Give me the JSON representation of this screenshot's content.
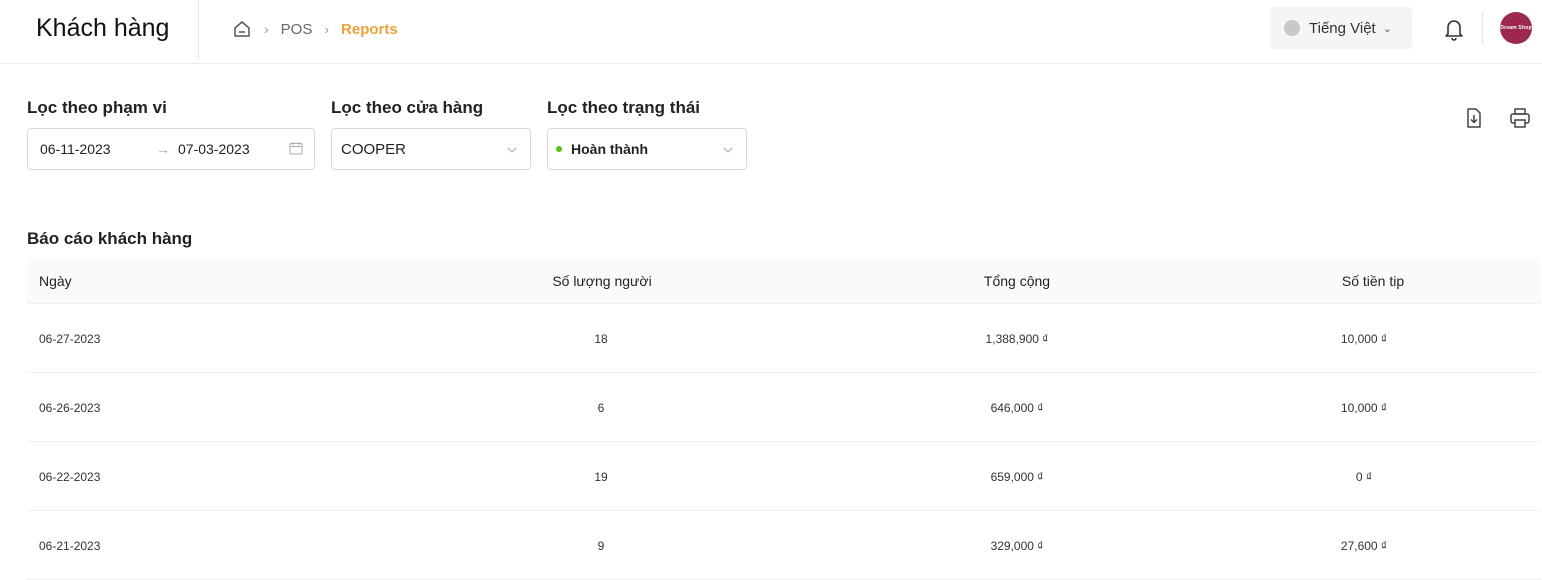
{
  "header": {
    "title": "Khách hàng",
    "breadcrumb": [
      {
        "label": "POS"
      },
      {
        "label": "Reports"
      }
    ],
    "language": "Tiếng Việt",
    "avatar_text": "Dream Shop"
  },
  "filters": {
    "range_label": "Lọc theo phạm vi",
    "start_date": "06-11-2023",
    "end_date": "07-03-2023",
    "store_label": "Lọc theo cửa hàng",
    "store_value": "COOPER",
    "status_label": "Lọc theo trạng thái",
    "status_value": "Hoàn thành"
  },
  "report": {
    "title": "Báo cáo khách hàng",
    "columns": [
      "Ngày",
      "Số lượng người",
      "Tổng cộng",
      "Số tiền tip"
    ],
    "rows": [
      {
        "date": "06-27-2023",
        "people": "18",
        "total": "1,388,900 ₫",
        "tip": "10,000 ₫"
      },
      {
        "date": "06-26-2023",
        "people": "6",
        "total": "646,000 ₫",
        "tip": "10,000 ₫"
      },
      {
        "date": "06-22-2023",
        "people": "19",
        "total": "659,000 ₫",
        "tip": "0 ₫"
      },
      {
        "date": "06-21-2023",
        "people": "9",
        "total": "329,000 ₫",
        "tip": "27,600 ₫"
      }
    ]
  },
  "colors": {
    "accent": "#e8a33d",
    "status_green": "#52c41a",
    "avatar_bg": "#9c2850"
  },
  "icons": {
    "home": "home-icon",
    "bell": "bell-icon",
    "export": "file-download-icon",
    "print": "printer-icon",
    "calendar": "calendar-icon"
  }
}
